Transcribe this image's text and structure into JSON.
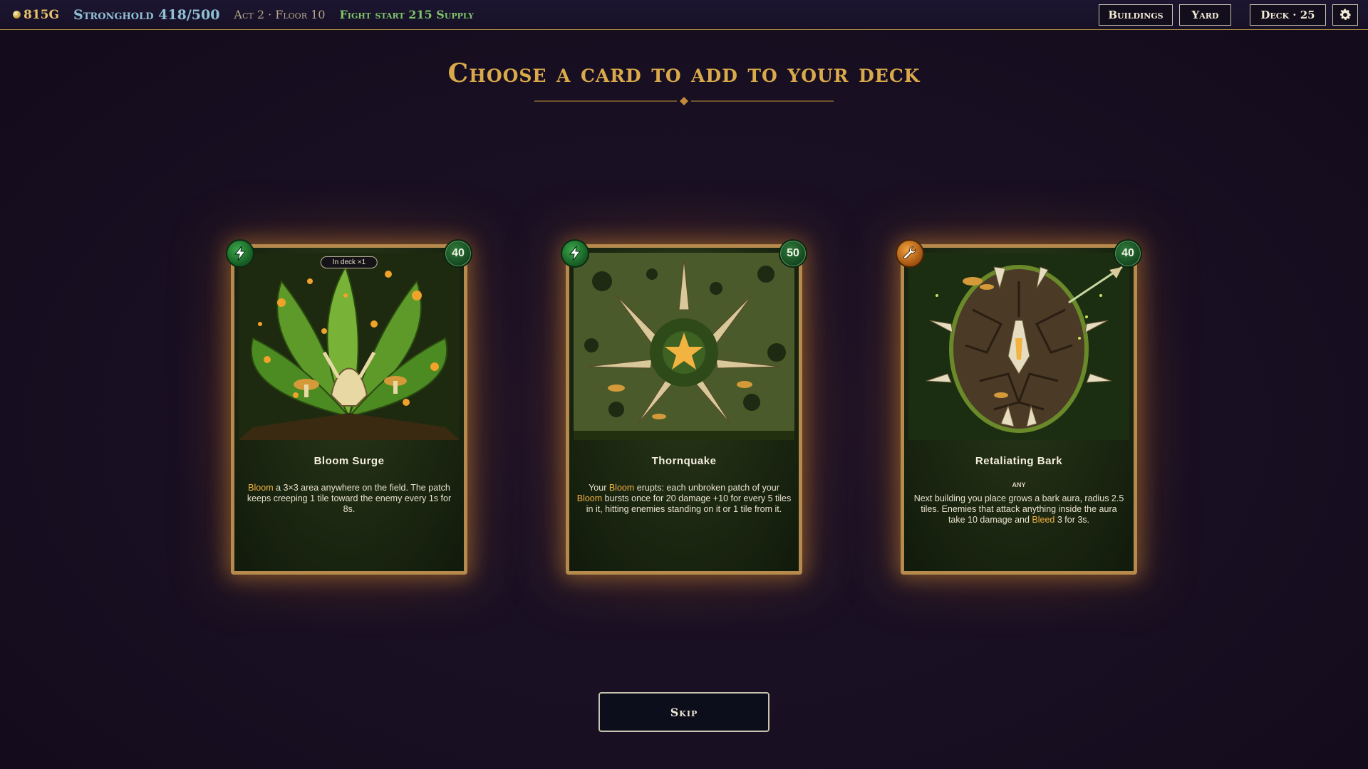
{
  "topbar": {
    "gold": "815G",
    "stronghold": "Stronghold 418/500",
    "location": "Act 2 · Floor 10",
    "fight_supply": "Fight start 215 Supply",
    "buttons": {
      "buildings": "Buildings",
      "yard": "Yard",
      "deck": "Deck · 25"
    },
    "settings_icon": "gear-icon"
  },
  "heading": "Choose a card to add to your deck",
  "cards": [
    {
      "name": "Bloom Surge",
      "cost": "40",
      "type_icon": "lightning-icon",
      "badge": "In deck ×1",
      "tag": "",
      "desc_keyword": "Bloom",
      "desc_rest": " a 3×3 area anywhere on the field. The patch keeps creeping 1 tile toward the enemy every 1s for 8s."
    },
    {
      "name": "Thornquake",
      "cost": "50",
      "type_icon": "lightning-icon",
      "tag": "",
      "desc_1": "Your ",
      "desc_kw1": "Bloom",
      "desc_2": " erupts: each unbroken patch of your ",
      "desc_kw2": "Bloom",
      "desc_3": " bursts once for 20 damage +10 for every 5 tiles in it, hitting enemies standing on it or 1 tile from it."
    },
    {
      "name": "Retaliating Bark",
      "cost": "40",
      "type_icon": "wrench-icon",
      "tag": "Any",
      "desc_1": "Next building you place grows a bark aura, radius 2.5 tiles. Enemies that attack anything inside the aura take 10 damage and ",
      "desc_kw": "Bleed",
      "desc_2": " 3 for 3s."
    }
  ],
  "skip_label": "Skip",
  "colors": {
    "accent_gold": "#d9a94a",
    "keyword": "#f2b341",
    "supply_green": "#7fc46a",
    "stronghold_blue": "#8fc0d6"
  }
}
